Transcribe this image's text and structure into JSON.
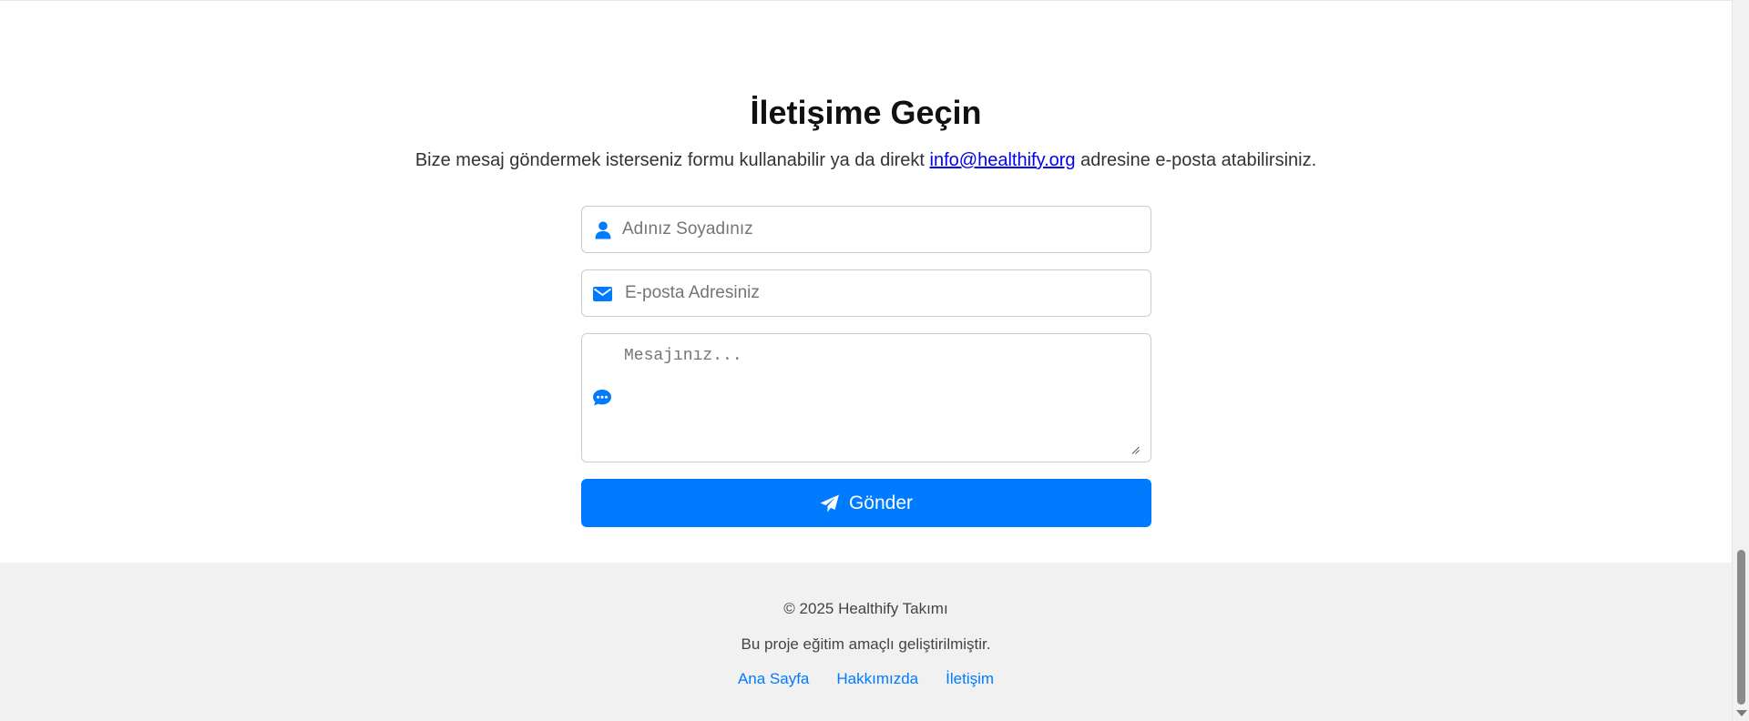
{
  "contact": {
    "title": "İletişime Geçin",
    "description_before": "Bize mesaj göndermek isterseniz formu kullanabilir ya da direkt ",
    "email_link": "info@healthify.org",
    "description_after": " adresine e-posta atabilirsiniz."
  },
  "form": {
    "name_placeholder": "Adınız Soyadınız",
    "email_placeholder": "E-posta Adresiniz",
    "message_placeholder": "Mesajınız...",
    "submit_label": "Gönder"
  },
  "icons": {
    "name": "user-icon",
    "email": "envelope-icon",
    "message": "comment-dots-icon",
    "submit": "paper-plane-icon"
  },
  "footer": {
    "copyright": "© 2025 Healthify Takımı",
    "note": "Bu proje eğitim amaçlı geliştirilmiştir.",
    "links": [
      {
        "label": "Ana Sayfa"
      },
      {
        "label": "Hakkımızda"
      },
      {
        "label": "İletişim"
      }
    ]
  },
  "colors": {
    "accent": "#007bff",
    "footer_bg": "#f1f1f1",
    "link": "#0000ee"
  }
}
